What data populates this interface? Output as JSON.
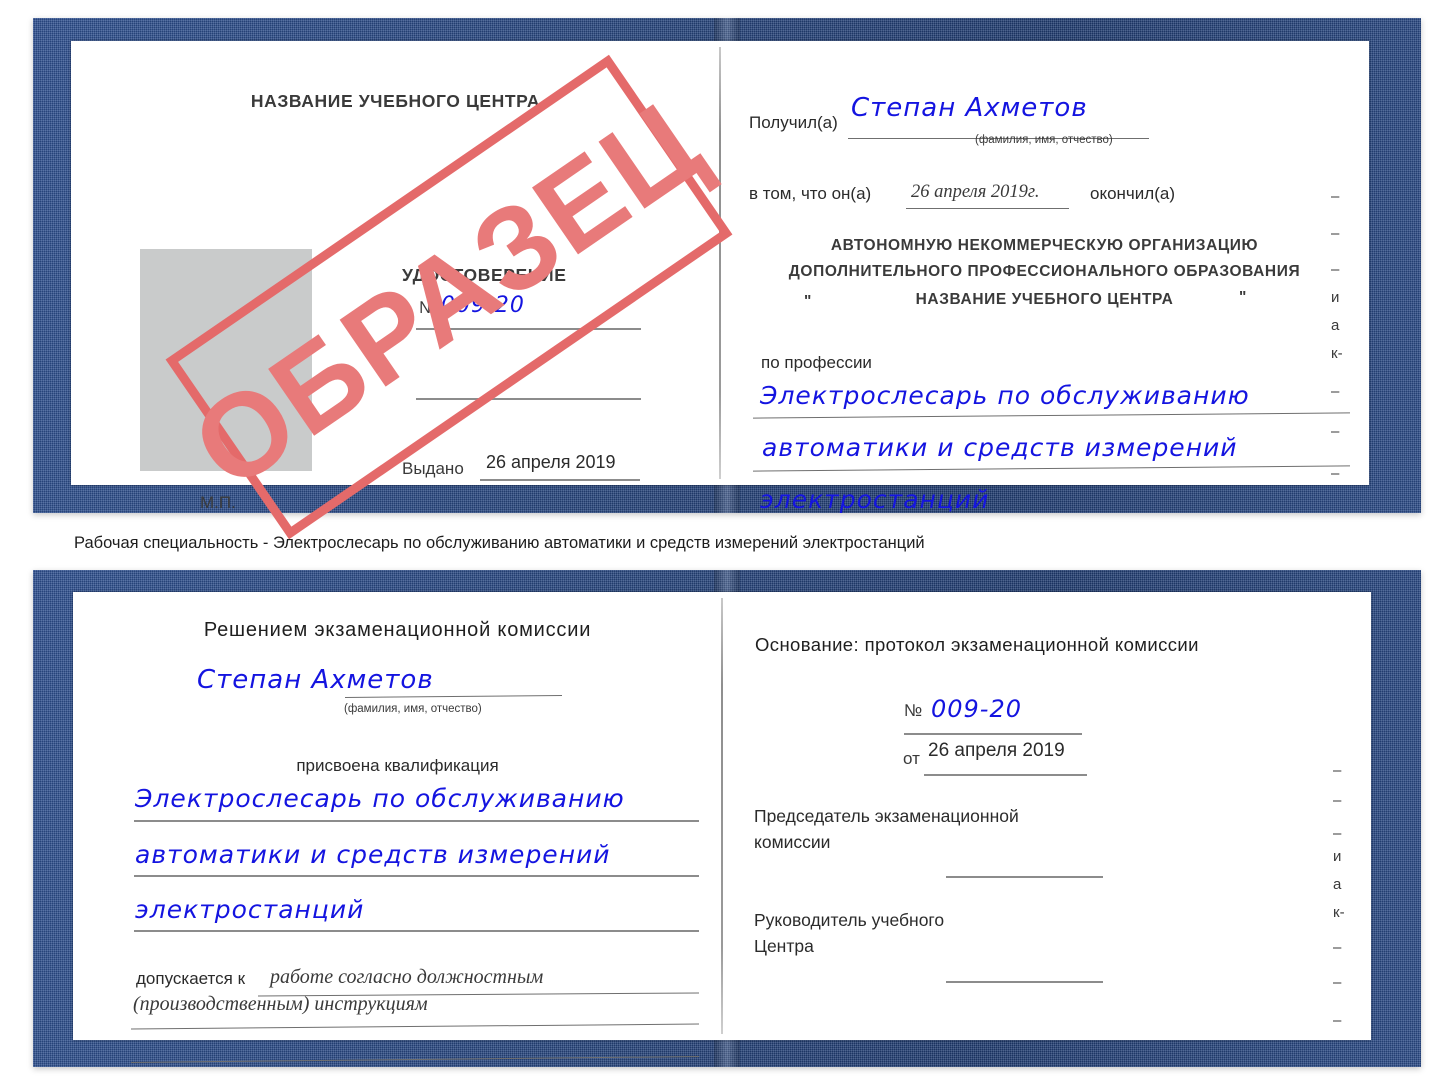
{
  "caption": {
    "text": "Рабочая специальность - Электрослесарь по обслуживанию автоматики и средств измерений электростанций"
  },
  "watermark": {
    "label": "ОБРАЗЕЦ",
    "color": "#e87a7a",
    "border_color": "#e46a6a"
  },
  "colors": {
    "cover_blue": "#27467f",
    "handwriting_blue": "#1414e0",
    "rule_gray": "#8c8c8c",
    "photo_gray": "#c9cbcb"
  },
  "certificate_top": {
    "left_page": {
      "center_name": "НАЗВАНИЕ УЧЕБНОГО ЦЕНТРА",
      "doc_type": "УДОСТОВЕРЕНИЕ",
      "number_label": "№",
      "number_value": "009-20",
      "issued_label": "Выдано",
      "issued_value": "26 апреля 2019",
      "stamp_label": "М.П.",
      "photo_placeholder": ""
    },
    "right_page": {
      "received_label": "Получил(а)",
      "received_value": "Степан Ахметов",
      "received_hint": "(фамилия, имя, отчество)",
      "that_he_label": "в том, что он(а)",
      "that_he_value": "26 апреля 2019г.",
      "graduated_label": "окончил(а)",
      "org_line1": "АВТОНОМНУЮ НЕКОММЕРЧЕСКУЮ ОРГАНИЗАЦИЮ",
      "org_line2": "ДОПОЛНИТЕЛЬНОГО ПРОФЕССИОНАЛЬНОГО ОБРАЗОВАНИЯ",
      "org_quote_open": "\"",
      "org_line3": "НАЗВАНИЕ УЧЕБНОГО ЦЕНТРА",
      "org_quote_close": "\"",
      "profession_label": "по профессии",
      "profession_line1": "Электрослесарь по обслуживанию",
      "profession_line2": "автоматики и средств измерений",
      "profession_line3": "электростанций"
    },
    "edge_fragments": [
      "–",
      "–",
      "–",
      "и",
      "а",
      "к-",
      "–",
      "–",
      "–"
    ]
  },
  "certificate_bottom": {
    "left_page": {
      "decision_title": "Решением экзаменационной комиссии",
      "name_value": "Степан Ахметов",
      "name_hint": "(фамилия, имя, отчество)",
      "qualification_label": "присвоена квалификация",
      "qualification_line1": "Электрослесарь по обслуживанию",
      "qualification_line2": "автоматики и средств измерений",
      "qualification_line3": "электростанций",
      "allowed_label": "допускается к",
      "allowed_value_line1": "работе согласно должностным",
      "allowed_value_line2": "(производственным) инструкциям"
    },
    "right_page": {
      "basis_label": "Основание: протокол экзаменационной комиссии",
      "number_label": "№",
      "number_value": "009-20",
      "date_label": "от",
      "date_value": "26 апреля 2019",
      "chairman_line1": "Председатель экзаменационной",
      "chairman_line2": "комиссии",
      "head_line1": "Руководитель учебного",
      "head_line2": "Центра"
    },
    "edge_fragments": [
      "–",
      "–",
      "–",
      "и",
      "а",
      "к-",
      "–",
      "–",
      "–"
    ]
  }
}
